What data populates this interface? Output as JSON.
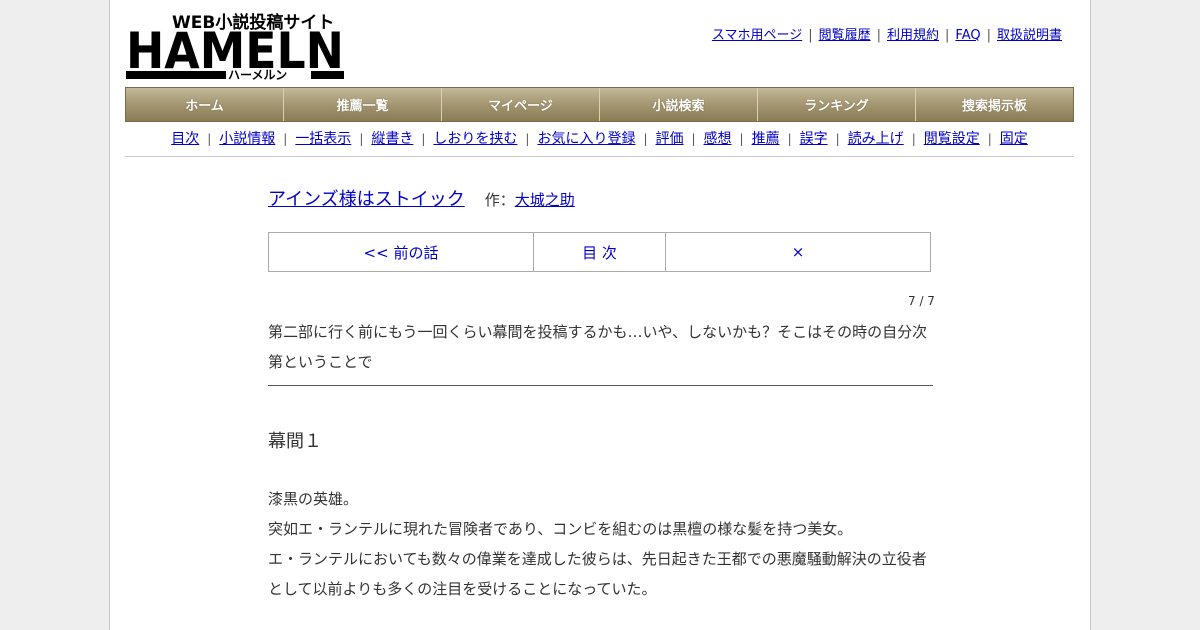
{
  "logo": {
    "tagline": "WEB小説投稿サイト",
    "name": "HAMELN",
    "kana": "ハーメルン"
  },
  "top_links": [
    "スマホ用ページ",
    "閲覧履歴",
    "利用規約",
    "FAQ",
    "取扱説明書"
  ],
  "main_nav": [
    "ホーム",
    "推薦一覧",
    "マイページ",
    "小説検索",
    "ランキング",
    "捜索掲示板"
  ],
  "sub_nav": [
    "目次",
    "小説情報",
    "一括表示",
    "縦書き",
    "しおりを挟む",
    "お気に入り登録",
    "評価",
    "感想",
    "推薦",
    "誤字",
    "読み上げ",
    "閲覧設定",
    "固定"
  ],
  "novel": {
    "title": "アインズ様はストイック",
    "author_label": "作：",
    "author": "大城之助"
  },
  "chapter_nav": {
    "prev": "<< 前の話",
    "toc": "目 次",
    "next": "×"
  },
  "page_count": "7 / 7",
  "preface": "第二部に行く前にもう一回くらい幕間を投稿するかも…いや、しないかも？そこはその時の自分次第ということで",
  "chapter_title": "幕間１",
  "body_lines": [
    "漆黒の英雄。",
    "突如エ・ランテルに現れた冒険者であり、コンビを組むのは黒檀の様な髪を持つ美女。",
    "エ・ランテルにおいても数々の偉業を達成した彼らは、先日起きた王都での悪魔騒動解決の立役者として以前よりも多くの注目を受けることになっていた。"
  ]
}
